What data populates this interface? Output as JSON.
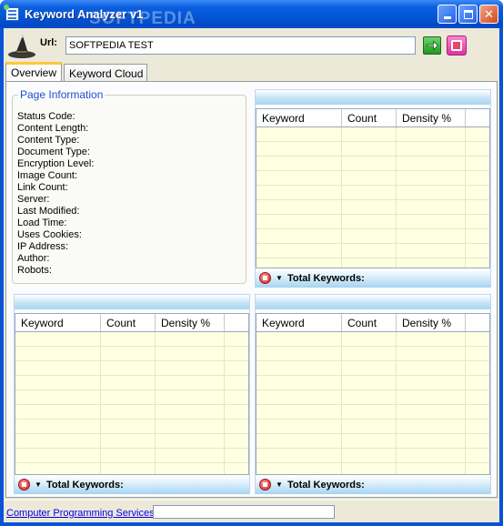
{
  "window": {
    "title": "Keyword Analyzer v1",
    "watermark": "SOFTPEDIA",
    "buttons": {
      "minimize": "minimize",
      "maximize": "maximize",
      "close": "✕"
    }
  },
  "toolbar": {
    "url_label": "Url:",
    "url_value": "SOFTPEDIA TEST"
  },
  "tabs": [
    {
      "label": "Overview",
      "active": true
    },
    {
      "label": "Keyword Cloud",
      "active": false
    }
  ],
  "page_info": {
    "title": "Page Information",
    "fields": [
      "Status Code:",
      "Content Length:",
      "Content Type:",
      "Document Type:",
      "Encryption Level:",
      "Image Count:",
      "Link Count:",
      "Server:",
      "Last Modified:",
      "Load Time:",
      "Uses Cookies:",
      "IP Address:",
      "Author:",
      "Robots:"
    ]
  },
  "keyword_panels": {
    "columns": [
      "Keyword",
      "Count",
      "Density %"
    ],
    "total_label": "Total Keywords:",
    "panels": [
      {
        "id": "top-right"
      },
      {
        "id": "bottom-left"
      },
      {
        "id": "bottom-right"
      }
    ]
  },
  "statusbar": {
    "link_text": "Computer Programming Services"
  }
}
